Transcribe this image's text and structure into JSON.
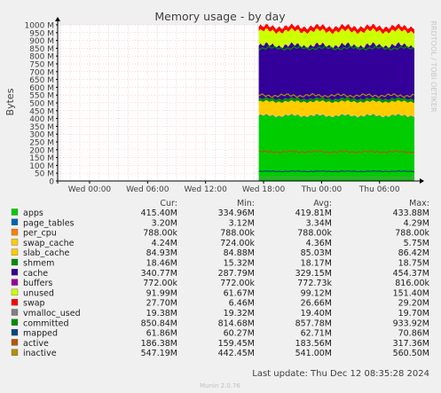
{
  "chart_data": {
    "type": "area",
    "title": "Memory usage - by day",
    "ylabel": "Bytes",
    "side_label": "RRDTOOL / TOBI OETIKER",
    "y_ticks": [
      "0",
      "50 M",
      "100 M",
      "150 M",
      "200 M",
      "250 M",
      "300 M",
      "350 M",
      "400 M",
      "450 M",
      "500 M",
      "550 M",
      "600 M",
      "650 M",
      "700 M",
      "750 M",
      "800 M",
      "850 M",
      "900 M",
      "950 M",
      "1000 M"
    ],
    "ylim": [
      0,
      1000
    ],
    "y_unit": "M",
    "x_ticks": [
      "Wed 00:00",
      "Wed 06:00",
      "Wed 12:00",
      "Wed 18:00",
      "Thu 00:00",
      "Thu 06:00"
    ],
    "x_tick_hours": [
      0,
      6,
      12,
      18,
      24,
      30
    ],
    "xlim_hours": [
      -3.3,
      33.6
    ],
    "data_start_hour": 17.5,
    "grid": true,
    "stack_order": [
      "apps",
      "page_tables",
      "per_cpu",
      "swap_cache",
      "slab_cache",
      "shmem",
      "cache",
      "buffers",
      "unused",
      "swap"
    ],
    "line_series": [
      "vmalloc_used",
      "committed",
      "mapped",
      "active",
      "inactive"
    ],
    "column_headers": [
      "Cur:",
      "Min:",
      "Avg:",
      "Max:"
    ],
    "series": [
      {
        "name": "apps",
        "color": "#00cc00",
        "cur": "415.40M",
        "min": "334.96M",
        "avg": "419.81M",
        "max": "433.88M",
        "value": 415.4
      },
      {
        "name": "page_tables",
        "color": "#0066b3",
        "cur": "3.20M",
        "min": "3.12M",
        "avg": "3.34M",
        "max": "4.29M",
        "value": 3.2
      },
      {
        "name": "per_cpu",
        "color": "#ff8000",
        "cur": "788.00k",
        "min": "788.00k",
        "avg": "788.00k",
        "max": "788.00k",
        "value": 0.8
      },
      {
        "name": "swap_cache",
        "color": "#ffcc00",
        "cur": "4.24M",
        "min": "724.00k",
        "avg": "4.36M",
        "max": "5.75M",
        "value": 4.24
      },
      {
        "name": "slab_cache",
        "color": "#ffcc00",
        "cur": "84.93M",
        "min": "84.88M",
        "avg": "85.03M",
        "max": "86.42M",
        "value": 84.93
      },
      {
        "name": "shmem",
        "color": "#008f00",
        "cur": "18.46M",
        "min": "15.32M",
        "avg": "18.17M",
        "max": "18.75M",
        "value": 18.46
      },
      {
        "name": "cache",
        "color": "#330099",
        "cur": "340.77M",
        "min": "287.79M",
        "avg": "329.15M",
        "max": "454.37M",
        "value": 340.77
      },
      {
        "name": "buffers",
        "color": "#990099",
        "cur": "772.00k",
        "min": "772.00k",
        "avg": "772.73k",
        "max": "816.00k",
        "value": 0.77
      },
      {
        "name": "unused",
        "color": "#ccff00",
        "cur": "91.99M",
        "min": "61.67M",
        "avg": "99.12M",
        "max": "151.40M",
        "value": 91.99
      },
      {
        "name": "swap",
        "color": "#ff0000",
        "cur": "27.70M",
        "min": "6.46M",
        "avg": "26.66M",
        "max": "29.20M",
        "value": 27.7
      },
      {
        "name": "vmalloc_used",
        "color": "#808080",
        "cur": "19.38M",
        "min": "19.32M",
        "avg": "19.40M",
        "max": "19.70M",
        "value": 19.38
      },
      {
        "name": "committed",
        "color": "#008f00",
        "cur": "850.84M",
        "min": "814.68M",
        "avg": "857.78M",
        "max": "933.92M",
        "value": 850.84
      },
      {
        "name": "mapped",
        "color": "#00487d",
        "cur": "61.86M",
        "min": "60.27M",
        "avg": "62.71M",
        "max": "70.86M",
        "value": 61.86
      },
      {
        "name": "active",
        "color": "#b35a00",
        "cur": "186.38M",
        "min": "159.45M",
        "avg": "183.56M",
        "max": "317.36M",
        "value": 186.38
      },
      {
        "name": "inactive",
        "color": "#b38f00",
        "cur": "547.19M",
        "min": "442.45M",
        "avg": "541.00M",
        "max": "560.50M",
        "value": 547.19
      }
    ]
  },
  "footer": {
    "last_update": "Last update: Thu Dec 12 08:35:28 2024",
    "version": "Munin 2.0.76"
  }
}
